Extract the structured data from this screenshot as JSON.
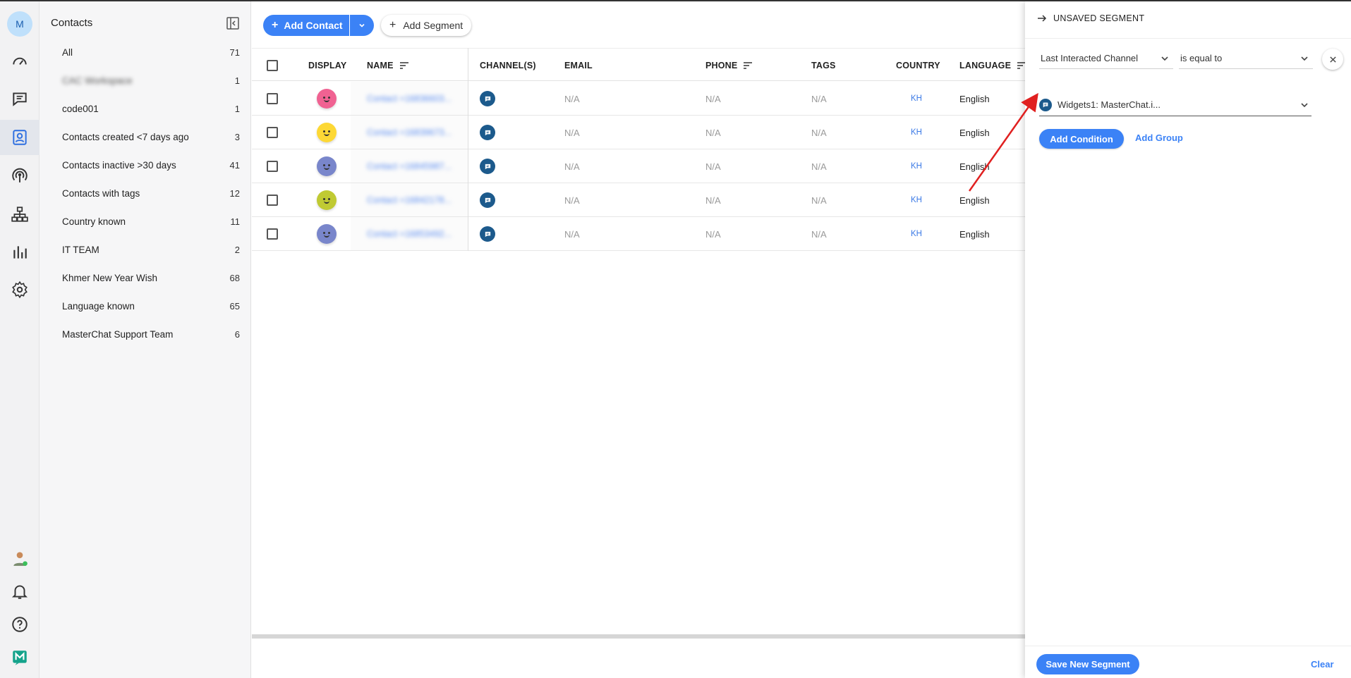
{
  "rail": {
    "avatar_initial": "M",
    "icons": [
      "dashboard-icon",
      "messages-icon",
      "contacts-icon",
      "broadcast-icon",
      "workflow-icon",
      "reports-icon",
      "settings-icon",
      "user-status-icon",
      "bell-icon",
      "help-icon",
      "app-logo-icon"
    ],
    "active": "contacts-icon"
  },
  "sidebar": {
    "title": "Contacts",
    "segments": [
      {
        "label": "All",
        "count": "71"
      },
      {
        "label": "CAC Workspace",
        "count": "1",
        "blurred": true
      },
      {
        "label": "code001",
        "count": "1"
      },
      {
        "label": "Contacts created <7 days ago",
        "count": "3"
      },
      {
        "label": "Contacts inactive >30 days",
        "count": "41"
      },
      {
        "label": "Contacts with tags",
        "count": "12"
      },
      {
        "label": "Country known",
        "count": "11"
      },
      {
        "label": "IT TEAM",
        "count": "2"
      },
      {
        "label": "Khmer New Year Wish",
        "count": "68"
      },
      {
        "label": "Language known",
        "count": "65"
      },
      {
        "label": "MasterChat Support Team",
        "count": "6"
      }
    ]
  },
  "toolbar": {
    "add_contact": "Add Contact",
    "add_segment": "Add Segment"
  },
  "table": {
    "headers": {
      "display": "DISPLAY",
      "name": "NAME",
      "channels": "CHANNEL(S)",
      "email": "EMAIL",
      "phone": "PHONE",
      "tags": "TAGS",
      "country": "COUNTRY",
      "language": "LANGUAGE"
    },
    "rows": [
      {
        "avatar_color": "#f06292",
        "name": "Contact +16836603...",
        "email": "N/A",
        "phone": "N/A",
        "tags": "N/A",
        "country": "KH",
        "language": "English"
      },
      {
        "avatar_color": "#fdd835",
        "name": "Contact +16839673...",
        "email": "N/A",
        "phone": "N/A",
        "tags": "N/A",
        "country": "KH",
        "language": "English"
      },
      {
        "avatar_color": "#7986cb",
        "name": "Contact +16845987...",
        "email": "N/A",
        "phone": "N/A",
        "tags": "N/A",
        "country": "KH",
        "language": "English"
      },
      {
        "avatar_color": "#c0ca33",
        "name": "Contact +16842178...",
        "email": "N/A",
        "phone": "N/A",
        "tags": "N/A",
        "country": "KH",
        "language": "English"
      },
      {
        "avatar_color": "#7986cb",
        "name": "Contact +16853492...",
        "email": "N/A",
        "phone": "N/A",
        "tags": "N/A",
        "country": "KH",
        "language": "English"
      }
    ]
  },
  "panel": {
    "title": "UNSAVED SEGMENT",
    "field": "Last Interacted Channel",
    "operator": "is equal to",
    "value": "Widgets1: MasterChat.i...",
    "add_condition": "Add Condition",
    "add_group": "Add Group",
    "save": "Save New Segment",
    "clear": "Clear"
  },
  "colors": {
    "accent": "#3b82f6",
    "channel": "#1c5a8c",
    "annotation_arrow": "#e02020"
  }
}
